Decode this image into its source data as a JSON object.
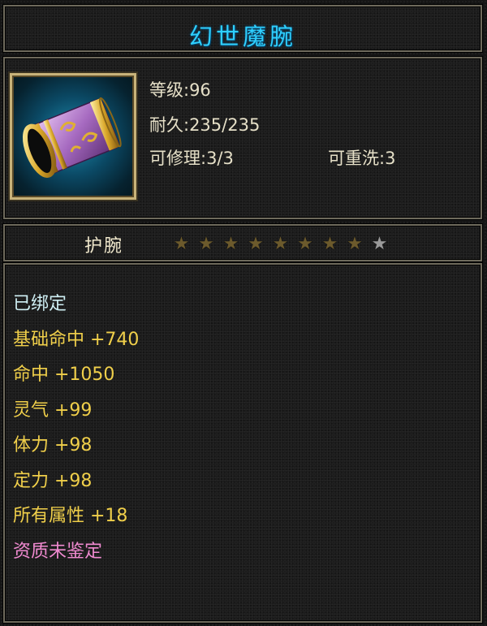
{
  "item": {
    "name": "幻世魔腕",
    "stats": {
      "level": "等级:96",
      "durability": "耐久:235/235",
      "repairable": "可修理:3/3",
      "rewashable": "可重洗:3"
    },
    "type": "护腕",
    "stars": {
      "filled": 8,
      "total": 9
    },
    "attributes": [
      {
        "text": "已绑定",
        "style": "bound"
      },
      {
        "text": "基础命中 +740",
        "style": "gold"
      },
      {
        "text": "命中 +1050",
        "style": "gold"
      },
      {
        "text": "灵气 +99",
        "style": "gold"
      },
      {
        "text": "体力 +98",
        "style": "gold"
      },
      {
        "text": "定力 +98",
        "style": "gold"
      },
      {
        "text": "所有属性 +18",
        "style": "gold"
      },
      {
        "text": "资质未鉴定",
        "style": "pink"
      }
    ]
  },
  "colors": {
    "title": "#2fd0ff",
    "bound_text": "#cfeff4",
    "attribute_text": "#f0cf4a",
    "quality_text": "#f08ad0",
    "frame": "#6e6a5c"
  },
  "icon": "bracer-icon"
}
